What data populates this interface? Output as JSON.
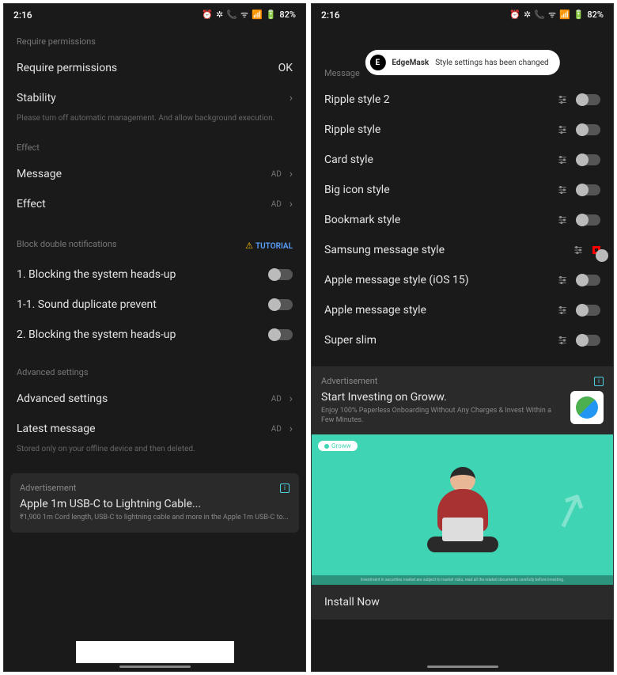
{
  "status": {
    "time": "2:16",
    "battery": "82%"
  },
  "left": {
    "sections": {
      "permissions": {
        "label": "Require permissions",
        "require": "Require permissions",
        "require_val": "OK",
        "stability": "Stability",
        "stability_note": "Please turn off automatic management. And allow background execution."
      },
      "effect": {
        "label": "Effect",
        "message": "Message",
        "effect": "Effect",
        "ad": "AD"
      },
      "block": {
        "label": "Block double notifications",
        "tutorial": "TUTORIAL",
        "i1": "1. Blocking the system heads-up",
        "i2": "1-1. Sound duplicate prevent",
        "i3": "2. Blocking the system heads-up"
      },
      "adv": {
        "label": "Advanced settings",
        "advanced": "Advanced settings",
        "latest": "Latest message",
        "note": "Stored only on your offline device and then deleted.",
        "ad": "AD"
      }
    },
    "ad": {
      "label": "Advertisement",
      "title": "Apple 1m USB-C to Lightning Cable...",
      "sub": "₹1,900 1m Cord length, USB-C to lightning cable and more in the Apple 1m USB-C to..."
    }
  },
  "right": {
    "toast": {
      "badge": "E",
      "app": "EdgeMask",
      "msg": "Style settings has been changed"
    },
    "section_label": "Message",
    "styles": [
      "Ripple style 2",
      "Ripple style",
      "Card style",
      "Big icon style",
      "Bookmark style",
      "Samsung message style",
      "Apple message style (iOS 15)",
      "Apple message style",
      "Super slim"
    ],
    "ad": {
      "label": "Advertisement",
      "title": "Start Investing on Groww.",
      "sub": "Enjoy 100% Paperless Onboarding Without Any Charges & Invest Within a Few Minutes.",
      "hero_badge": "Groww",
      "disclaimer": "Investment in securities market are subject to market risks, read all the related documents carefully before investing.",
      "install": "Install Now"
    }
  }
}
